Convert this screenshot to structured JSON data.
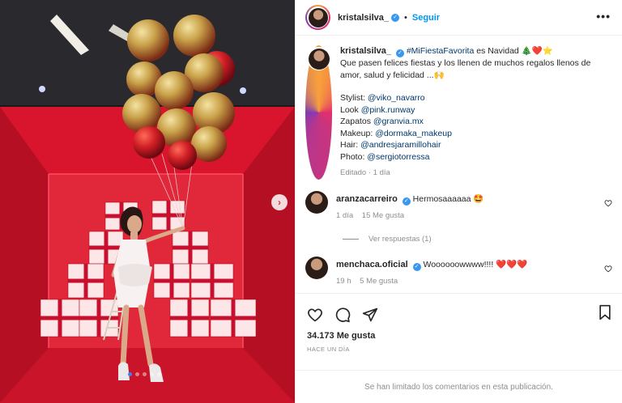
{
  "post": {
    "author": "kristalsilva_",
    "follow_label": "Seguir",
    "more_label": "•••"
  },
  "caption": {
    "author": "kristalsilva_",
    "hashtag": "#MiFiestaFavorita",
    "title_rest": " es Navidad 🎄❤️⭐",
    "body": "Que pasen felices fiestas y los llenen de muchos regalos llenos de amor, salud y felicidad ...🙌",
    "credits": [
      {
        "label": "Stylist: ",
        "handle": "@viko_navarro"
      },
      {
        "label": "Look ",
        "handle": "@pink.runway"
      },
      {
        "label": "Zapatos ",
        "handle": "@granvia.mx"
      },
      {
        "label": "Makeup: ",
        "handle": "@dormaka_makeup"
      },
      {
        "label": "Hair: ",
        "handle": "@andresjaramillohair"
      },
      {
        "label": "Photo: ",
        "handle": "@sergiotorressa"
      }
    ],
    "meta": "Editado · 1 día"
  },
  "comments": [
    {
      "user": "aranzacarreiro",
      "text": "Hermosaaaaaa 🤩",
      "time": "1 día",
      "likes": "15 Me gusta",
      "replies": "Ver respuestas (1)"
    },
    {
      "user": "menchaca.oficial",
      "text": "Woooooowwww!!!! ❤️❤️❤️",
      "time": "19 h",
      "likes": "5 Me gusta"
    }
  ],
  "actions": {
    "likes": "34.173 Me gusta",
    "posted": "HACE UN DÍA",
    "comments_limited": "Se han limitado los comentarios en esta publicación."
  },
  "carousel": {
    "total": 5,
    "active": 0
  },
  "icons": [
    "more-icon",
    "verified-icon",
    "heart-icon",
    "comment-icon",
    "share-icon",
    "bookmark-icon",
    "next-arrow-icon"
  ],
  "colors": {
    "accent": "#0095f6",
    "verified": "#3897f0",
    "scene_red": "#d8152d",
    "balloon_gold": "#c9a24a"
  }
}
